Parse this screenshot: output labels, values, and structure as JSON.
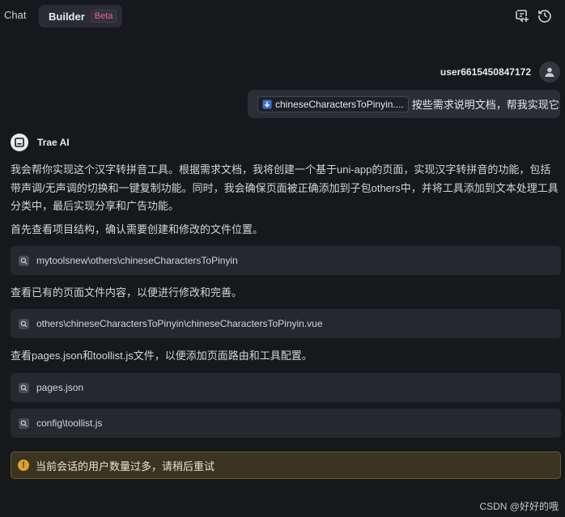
{
  "tabs": {
    "chat": "Chat",
    "builder": "Builder",
    "beta": "Beta"
  },
  "user": {
    "name": "user6615450847172"
  },
  "user_message": {
    "file_chip": "chineseCharactersToPinyin....",
    "text": "按些需求说明文档，帮我实现它"
  },
  "ai": {
    "name": "Trae AI",
    "para1": "我会帮你实现这个汉字转拼音工具。根据需求文档，我将创建一个基于uni-app的页面，实现汉字转拼音的功能，包括带声调/无声调的切换和一键复制功能。同时，我会确保页面被正确添加到子包others中，并将工具添加到文本处理工具分类中，最后实现分享和广告功能。",
    "para2": "首先查看项目结构，确认需要创建和修改的文件位置。",
    "tool1": "mytoolsnew\\others\\chineseCharactersToPinyin",
    "para3": "查看已有的页面文件内容，以便进行修改和完善。",
    "tool2": "others\\chineseCharactersToPinyin\\chineseCharactersToPinyin.vue",
    "para4": "查看pages.json和toollist.js文件，以便添加页面路由和工具配置。",
    "tool3": "pages.json",
    "tool4": "config\\toollist.js"
  },
  "warning": {
    "text": "当前会话的用户数量过多，请稍后重试"
  },
  "watermark": "CSDN @好好的哦",
  "colors": {
    "background": "#17181c",
    "card": "#26282e",
    "warning_bg": "#3a3420",
    "beta": "#e06c8a"
  }
}
